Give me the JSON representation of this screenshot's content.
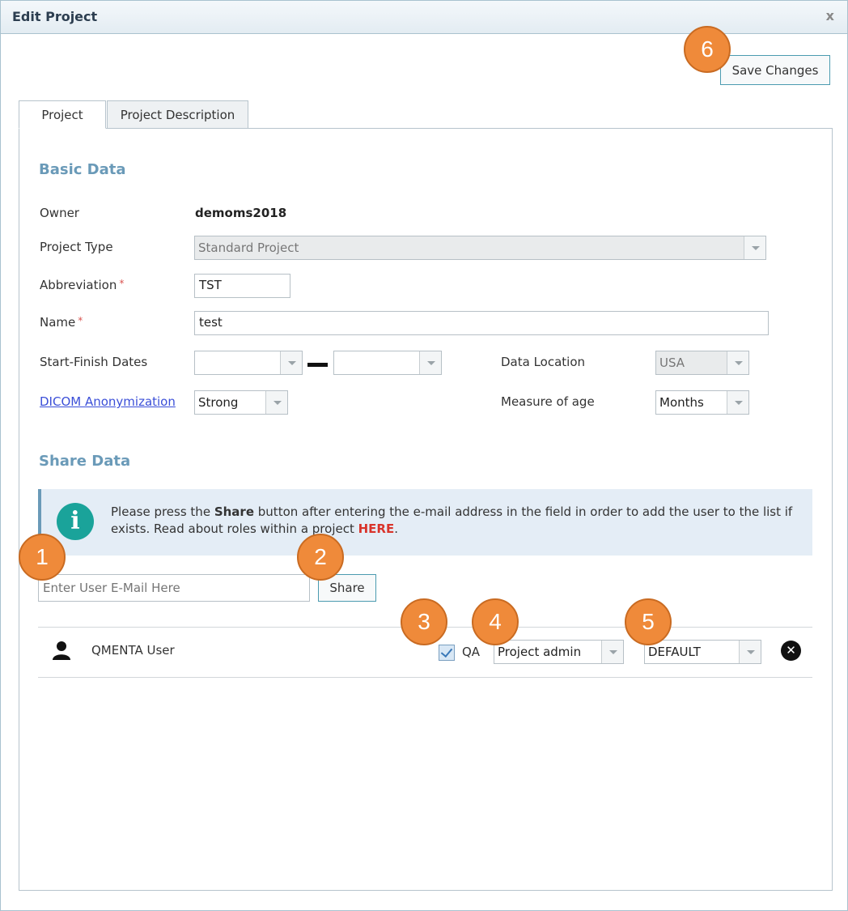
{
  "dialog": {
    "title": "Edit Project",
    "close_label": "x",
    "save_label": "Save Changes"
  },
  "tabs": [
    {
      "label": "Project",
      "active": true
    },
    {
      "label": "Project Description",
      "active": false
    }
  ],
  "basic_data": {
    "title": "Basic Data",
    "owner_label": "Owner",
    "owner_value": "demoms2018",
    "project_type_label": "Project Type",
    "project_type_value": "Standard Project",
    "abbreviation_label": "Abbreviation",
    "abbreviation_value": "TST",
    "name_label": "Name",
    "name_value": "test",
    "required_mark": "*",
    "dates_label": "Start-Finish Dates",
    "start_date_value": "",
    "finish_date_value": "",
    "data_location_label": "Data Location",
    "data_location_value": "USA",
    "dicom_label": "DICOM Anonymization",
    "dicom_value": "Strong",
    "measure_age_label": "Measure of age",
    "measure_age_value": "Months"
  },
  "share_data": {
    "title": "Share Data",
    "info_text_before": "Please press the ",
    "info_text_bold": "Share",
    "info_text_after": " button after entering the e-mail address in the field in order to add the user to the list if exists. Read about roles within a project ",
    "info_link": "HERE",
    "info_end": ".",
    "email_placeholder": "Enter User E-Mail Here",
    "share_button": "Share",
    "users": [
      {
        "name": "QMENTA User",
        "qa_label": "QA",
        "qa_checked": true,
        "role": "Project admin",
        "group": "DEFAULT"
      }
    ]
  },
  "callouts": [
    "1",
    "2",
    "3",
    "4",
    "5",
    "6"
  ],
  "icons": {
    "user": "user-icon",
    "info": "info-icon",
    "remove": "remove-circle-icon"
  },
  "colors": {
    "section_title": "#6a9ab8",
    "callout": "#ef8a3a",
    "info_bg": "#e4edf6",
    "info_icon": "#1aa39a",
    "link": "#3b4fd8",
    "here_link": "#d9342b"
  }
}
